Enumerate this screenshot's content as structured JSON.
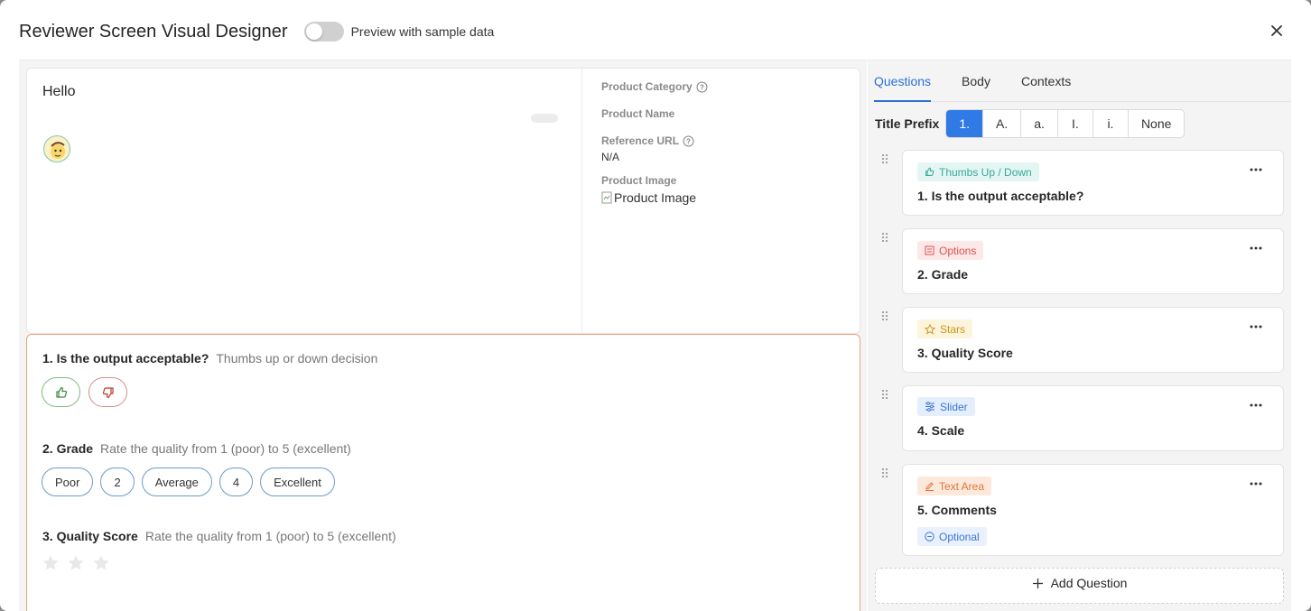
{
  "header": {
    "title": "Reviewer Screen Visual Designer",
    "preview_label": "Preview with sample data",
    "preview_on": false
  },
  "preview": {
    "greeting": "Hello",
    "meta": [
      {
        "label": "Product Category",
        "help": true,
        "value": ""
      },
      {
        "label": "Product Name",
        "help": false,
        "value": ""
      },
      {
        "label": "Reference URL",
        "help": true,
        "value": "N/A"
      },
      {
        "label": "Product Image",
        "help": false,
        "value": "Product Image"
      }
    ]
  },
  "questions_preview": [
    {
      "title": "1. Is the output acceptable?",
      "desc": "Thumbs up or down decision"
    },
    {
      "title": "2. Grade",
      "desc": "Rate the quality from 1 (poor) to 5 (excellent)",
      "options": [
        "Poor",
        "2",
        "Average",
        "4",
        "Excellent"
      ]
    },
    {
      "title": "3. Quality Score",
      "desc": "Rate the quality from 1 (poor) to 5 (excellent)"
    }
  ],
  "sidebar": {
    "tabs": [
      "Questions",
      "Body",
      "Contexts"
    ],
    "active_tab": "Questions",
    "title_prefix_label": "Title Prefix",
    "title_prefix_options": [
      "1.",
      "A.",
      "a.",
      "I.",
      "i.",
      "None"
    ],
    "title_prefix_selected": "1.",
    "questions": [
      {
        "type": "Thumbs Up / Down",
        "icon": "thumbs-up-icon",
        "name": "1. Is the output acceptable?",
        "tag_bg": "#e3f6f3",
        "tag_fg": "#3aa898"
      },
      {
        "type": "Options",
        "icon": "options-icon",
        "name": "2. Grade",
        "tag_bg": "#fde8e8",
        "tag_fg": "#d9534f"
      },
      {
        "type": "Stars",
        "icon": "star-icon",
        "name": "3. Quality Score",
        "tag_bg": "#fdf4dc",
        "tag_fg": "#c9961a"
      },
      {
        "type": "Slider",
        "icon": "slider-icon",
        "name": "4. Scale",
        "tag_bg": "#e5eefc",
        "tag_fg": "#3b76d6"
      },
      {
        "type": "Text Area",
        "icon": "pencil-icon",
        "name": "5. Comments",
        "tag_bg": "#fde9dc",
        "tag_fg": "#e0733a",
        "optional_label": "Optional"
      }
    ],
    "add_label": "Add Question"
  }
}
